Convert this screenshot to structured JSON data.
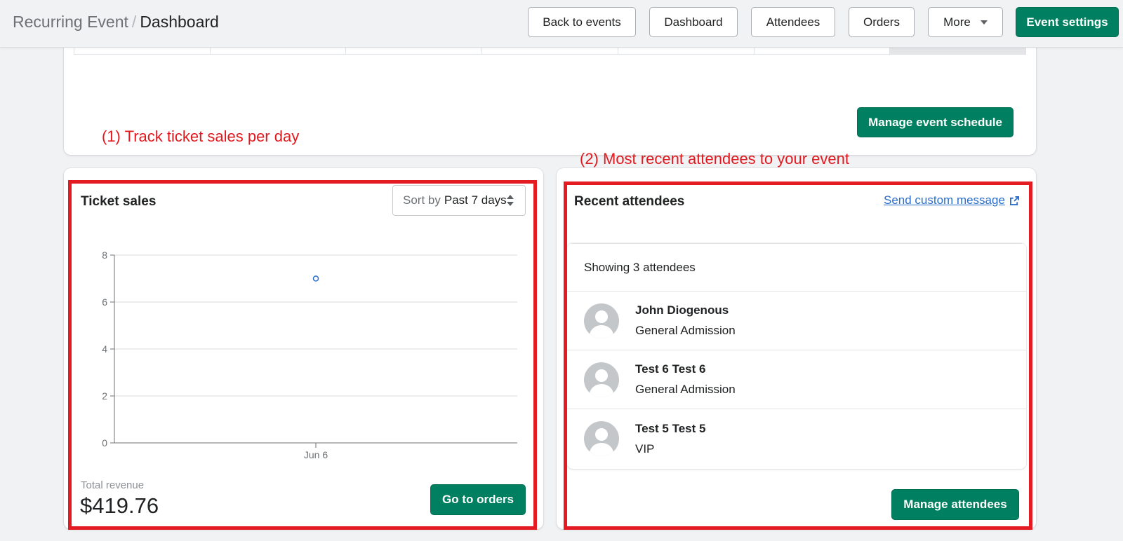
{
  "header": {
    "breadcrumb_parent": "Recurring Event",
    "breadcrumb_separator": "/",
    "breadcrumb_current": "Dashboard",
    "buttons": {
      "back": "Back to events",
      "dashboard": "Dashboard",
      "attendees": "Attendees",
      "orders": "Orders",
      "more": "More",
      "settings": "Event settings"
    }
  },
  "schedule": {
    "manage_label": "Manage event schedule"
  },
  "annotations": {
    "one": "(1) Track ticket sales per day",
    "two": "(2) Most recent attendees to your event"
  },
  "ticket_sales": {
    "title": "Ticket sales",
    "sort_prefix": "Sort by",
    "sort_value": "Past 7 days",
    "revenue_label": "Total revenue",
    "revenue_value": "$419.76",
    "orders_button": "Go to orders"
  },
  "chart_data": {
    "type": "scatter",
    "x": [
      "Jun 6"
    ],
    "series": [
      {
        "values": [
          7
        ]
      }
    ],
    "xlabel": "",
    "ylabel": "",
    "ylim": [
      0,
      8
    ],
    "yticks": [
      0,
      2,
      4,
      6,
      8
    ],
    "grid": true,
    "color": "#2c6ecb"
  },
  "recent_attendees": {
    "title": "Recent attendees",
    "message_link": "Send custom message",
    "showing": "Showing 3 attendees",
    "items": [
      {
        "name": "John Diogenous",
        "ticket": "General Admission"
      },
      {
        "name": "Test 6 Test 6",
        "ticket": "General Admission"
      },
      {
        "name": "Test 5 Test 5",
        "ticket": "VIP"
      }
    ],
    "manage_button": "Manage attendees"
  },
  "colors": {
    "primary": "#008060",
    "annotation": "#e41b23",
    "link": "#2c6ecb"
  }
}
